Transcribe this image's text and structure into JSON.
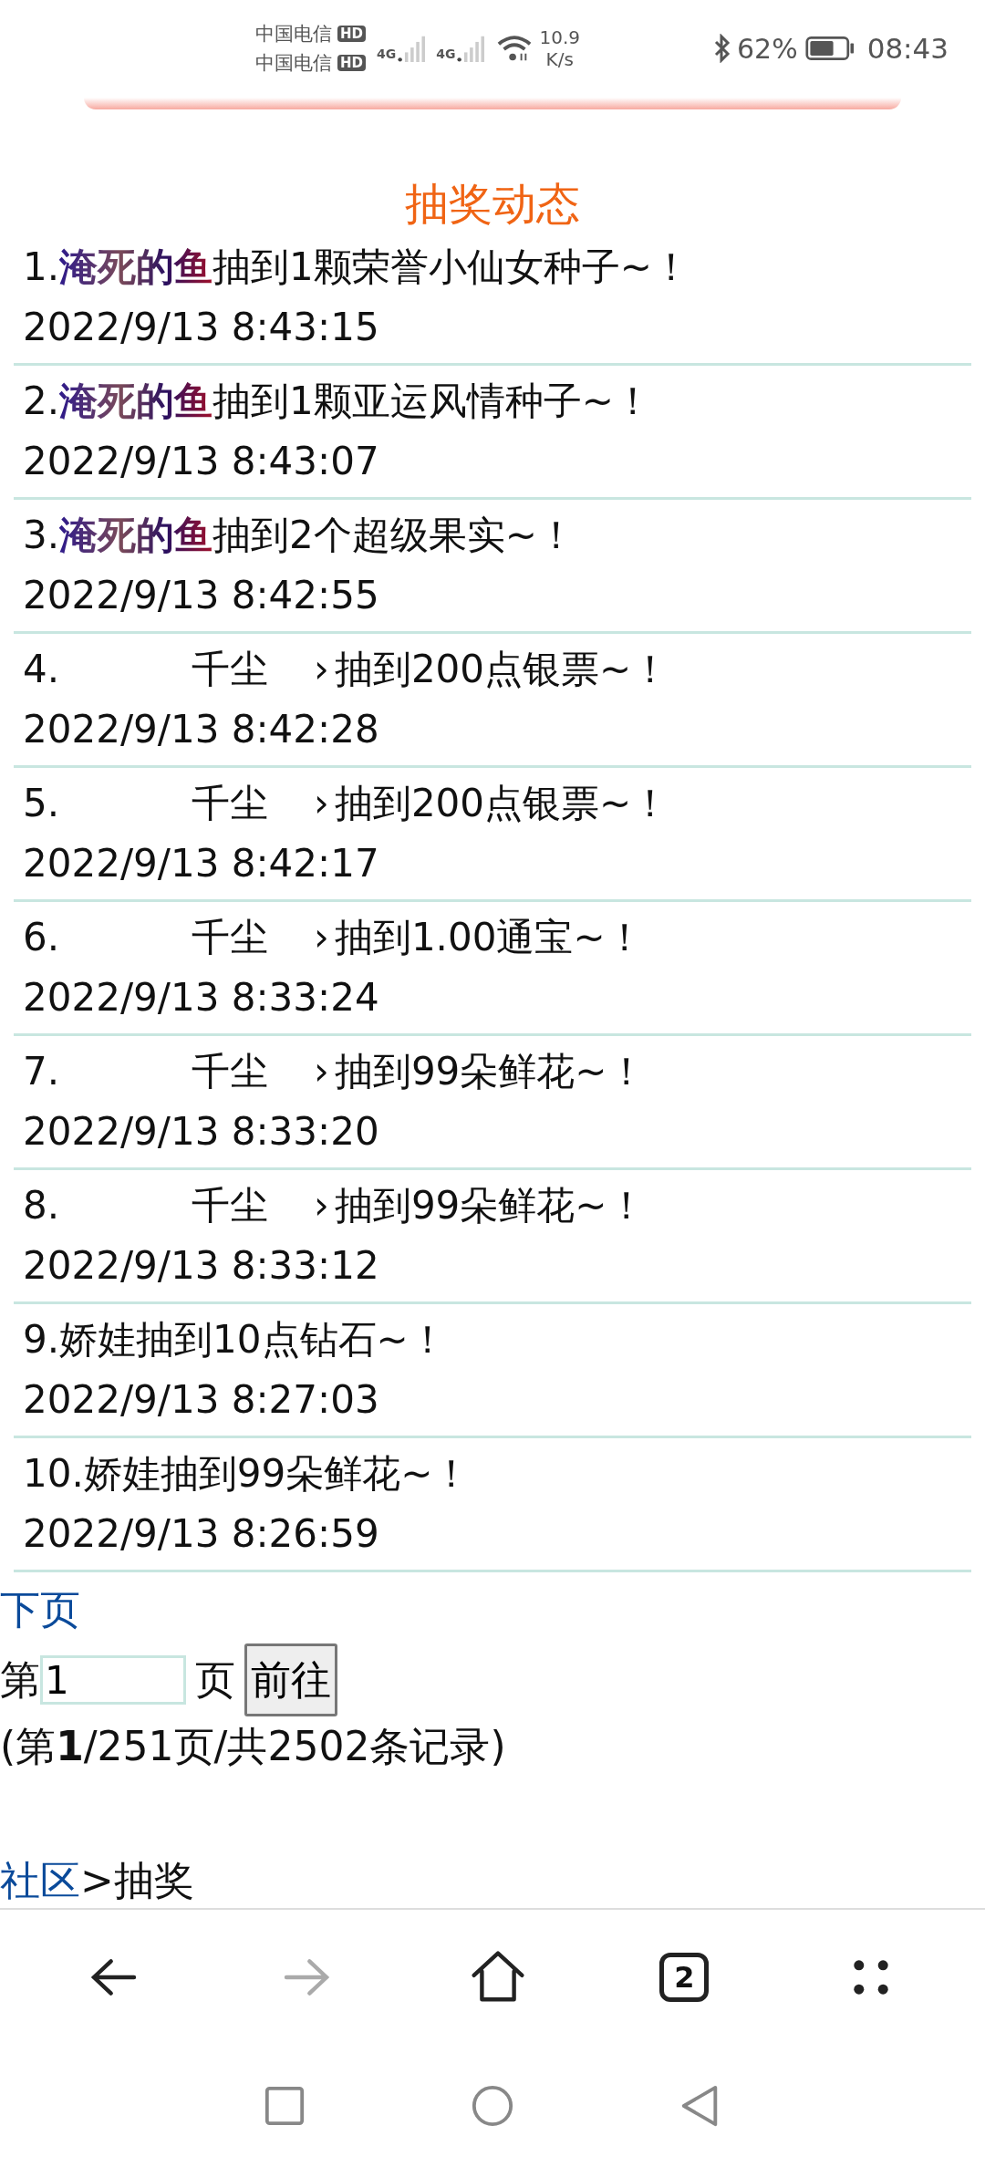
{
  "status_bar": {
    "carriers": [
      {
        "name": "中国电信",
        "badge": "HD"
      },
      {
        "name": "中国电信",
        "badge": "HD"
      }
    ],
    "networks": [
      "4G",
      "4G"
    ],
    "speed": [
      "10.9",
      "K/s"
    ],
    "battery": "62%",
    "time": "08:43"
  },
  "title": "抽奖动态",
  "records": [
    {
      "no": "1.",
      "name": "淹死的鱼",
      "kind": "gradient",
      "text": "抽到1颗荣誉小仙女种子~！",
      "time": "2022/9/13 8:43:15"
    },
    {
      "no": "2.",
      "name": "淹死的鱼",
      "kind": "gradient",
      "text": "抽到1颗亚运风情种子~！",
      "time": "2022/9/13 8:43:07"
    },
    {
      "no": "3.",
      "name": "淹死的鱼",
      "kind": "gradient",
      "text": "抽到2个超级果实~！",
      "time": "2022/9/13 8:42:55"
    },
    {
      "no": "4.",
      "name": "千尘",
      "kind": "spaced",
      "name_tail": "›",
      "text": "抽到200点银票~！",
      "time": "2022/9/13 8:42:28"
    },
    {
      "no": "5.",
      "name": "千尘",
      "kind": "spaced",
      "name_tail": "›",
      "text": "抽到200点银票~！",
      "time": "2022/9/13 8:42:17"
    },
    {
      "no": "6.",
      "name": "千尘",
      "kind": "spaced",
      "name_tail": "›",
      "text": "抽到1.00通宝~！",
      "time": "2022/9/13 8:33:24"
    },
    {
      "no": "7.",
      "name": "千尘",
      "kind": "spaced",
      "name_tail": "›",
      "text": "抽到99朵鲜花~！",
      "time": "2022/9/13 8:33:20"
    },
    {
      "no": "8.",
      "name": "千尘",
      "kind": "spaced",
      "name_tail": "›",
      "text": "抽到99朵鲜花~！",
      "time": "2022/9/13 8:33:12"
    },
    {
      "no": "9.",
      "name": "娇娃",
      "kind": "plain",
      "text": "抽到10点钻石~！",
      "time": "2022/9/13 8:27:03"
    },
    {
      "no": "10.",
      "name": "娇娃",
      "kind": "plain",
      "text": "抽到99朵鲜花~！",
      "time": "2022/9/13 8:26:59"
    }
  ],
  "next_page": "下页",
  "jump": {
    "prefix": "第",
    "value": "1",
    "suffix": "页",
    "button": "前往"
  },
  "summary": "(第**1**/251页/共2502条记录)",
  "breadcrumb": {
    "link": "社区",
    "rest": ">抽奖"
  },
  "toolbar": {
    "tab_count": "2"
  }
}
